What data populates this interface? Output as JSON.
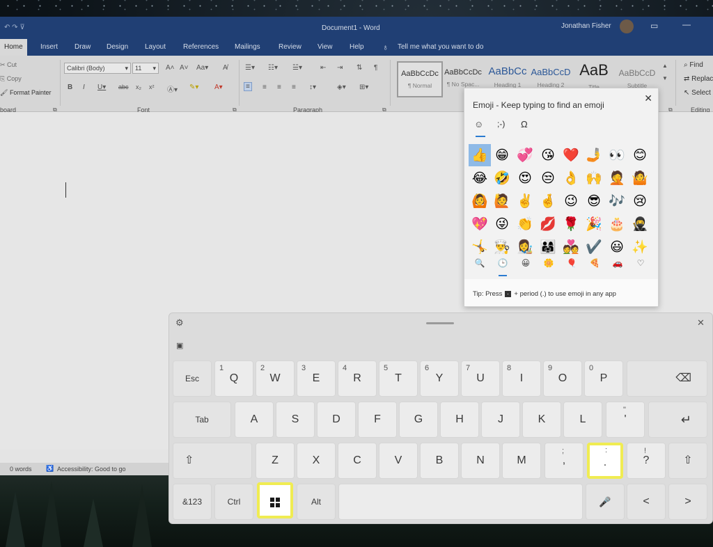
{
  "word": {
    "title": "Document1 - Word",
    "user": "Jonathan Fisher",
    "tabs": [
      "Home",
      "Insert",
      "Draw",
      "Design",
      "Layout",
      "References",
      "Mailings",
      "Review",
      "View",
      "Help"
    ],
    "tell_me": "Tell me what you want to do",
    "clipboard": {
      "cut": "Cut",
      "copy": "Copy",
      "format_painter": "Format Painter",
      "group": "board"
    },
    "font": {
      "name": "Calibri (Body)",
      "size": "11",
      "group": "Font"
    },
    "paragraph_group": "Paragraph",
    "styles": [
      {
        "preview": "AaBbCcDc",
        "name": "¶ Normal"
      },
      {
        "preview": "AaBbCcDc",
        "name": "¶ No Spac..."
      },
      {
        "preview": "AaBbCc",
        "name": "Heading 1"
      },
      {
        "preview": "AaBbCcD",
        "name": "Heading 2"
      },
      {
        "preview": "AaB",
        "name": "Title"
      },
      {
        "preview": "AaBbCcD",
        "name": "Subtitle"
      }
    ],
    "editing": {
      "find": "Find",
      "replace": "Replace",
      "select": "Select",
      "group": "Editing"
    },
    "status": {
      "words": "0 words",
      "accessibility": "Accessibility: Good to go"
    }
  },
  "emoji_panel": {
    "title": "Emoji - Keep typing to find an emoji",
    "tabs": [
      "☺",
      ";-)",
      "Ω"
    ],
    "emojis": [
      [
        "👍",
        "😁",
        "💞",
        "😘",
        "❤️",
        "🤳",
        "👀",
        "😊"
      ],
      [
        "😂",
        "🤣",
        "😍",
        "😒",
        "👌",
        "🙌",
        "🤦",
        "🤷"
      ],
      [
        "🙆",
        "🙋",
        "✌️",
        "🤞",
        "😉",
        "😎",
        "🎶",
        "😢"
      ],
      [
        "💖",
        "😜",
        "👏",
        "💋",
        "🌹",
        "🎉",
        "🎂",
        "🥷"
      ],
      [
        "🤸",
        "👨‍🍳",
        "👩‍🎨",
        "👨‍👩‍👧",
        "💑",
        "✔️",
        "😃",
        "✨"
      ]
    ],
    "categories": [
      "🔍",
      "🕒",
      "😀",
      "🌼",
      "🎈",
      "🍕",
      "🚗",
      "♡"
    ],
    "tip_prefix": "Tip: Press",
    "tip_suffix": "+ period (.) to use emoji in any app"
  },
  "keyboard": {
    "row1": [
      {
        "label": "Esc",
        "fn": true
      },
      {
        "label": "Q",
        "num": "1"
      },
      {
        "label": "W",
        "num": "2"
      },
      {
        "label": "E",
        "num": "3"
      },
      {
        "label": "R",
        "num": "4"
      },
      {
        "label": "T",
        "num": "5"
      },
      {
        "label": "Y",
        "num": "6"
      },
      {
        "label": "U",
        "num": "7"
      },
      {
        "label": "I",
        "num": "8"
      },
      {
        "label": "O",
        "num": "9"
      },
      {
        "label": "P",
        "num": "0"
      },
      {
        "label": "⌫",
        "fn": true
      }
    ],
    "row2": [
      "Tab",
      "A",
      "S",
      "D",
      "F",
      "G",
      "H",
      "J",
      "K",
      "L",
      "'",
      "↵"
    ],
    "row2_punct_top": "\"",
    "row3": [
      "⇧",
      "Z",
      "X",
      "C",
      "V",
      "B",
      "N",
      "M",
      ",",
      ".",
      "?",
      "⇧"
    ],
    "row3_punct_top": [
      ";",
      ":",
      "!"
    ],
    "row4": [
      "&123",
      "Ctrl",
      "win",
      "Alt",
      "",
      "🎤",
      "<",
      ">"
    ]
  }
}
